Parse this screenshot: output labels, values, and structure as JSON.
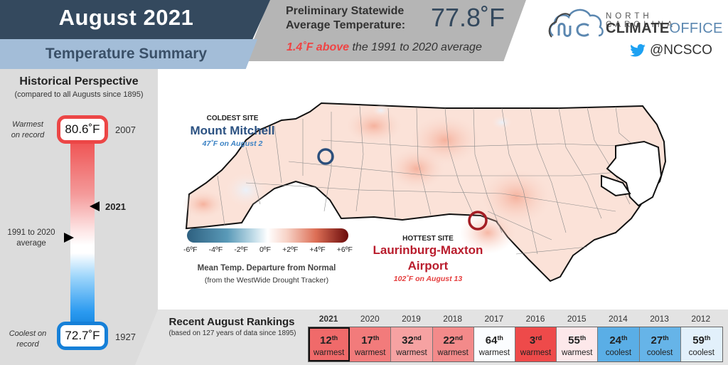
{
  "header": {
    "title": "August 2021",
    "subtitle": "Temperature Summary",
    "prelim_label_line1": "Preliminary Statewide",
    "prelim_label_line2": "Average Temperature:",
    "prelim_value": "77.8˚F",
    "departure_highlight": "1.4˚F above",
    "departure_rest": " the 1991 to 2020 average"
  },
  "logo": {
    "line1": "NORTH CAROLINA",
    "line2_bold": "CLIMATE",
    "line2_light": "OFFICE",
    "twitter_handle": "@NCSCO"
  },
  "historical": {
    "title": "Historical Perspective",
    "subtitle": "(compared to all Augusts since 1895)",
    "warmest_label_1": "Warmest",
    "warmest_label_2": "on record",
    "warmest_value": "80.6˚F",
    "warmest_year": "2007",
    "coolest_label_1": "Coolest on",
    "coolest_label_2": "record",
    "coolest_value": "72.7˚F",
    "coolest_year": "1927",
    "current_year_marker": "2021",
    "average_label_1": "1991 to 2020",
    "average_label_2": "average",
    "colors": {
      "warm": "#ec4646",
      "cool": "#1680d8"
    }
  },
  "map": {
    "coldest": {
      "kicker": "COLDEST SITE",
      "name": "Mount Mitchell",
      "detail": "47˚F on August 2",
      "color": "#2c5282"
    },
    "hottest": {
      "kicker": "HOTTEST SITE",
      "name_line1": "Laurinburg-Maxton",
      "name_line2": "Airport",
      "detail": "102˚F on August 13",
      "color": "#b91c2c"
    },
    "legend": {
      "ticks": [
        "-6ºF",
        "-4ºF",
        "-2ºF",
        "0ºF",
        "+2ºF",
        "+4ºF",
        "+6ºF"
      ],
      "caption": "Mean Temp. Departure from Normal",
      "source": "(from the WestWide Drought Tracker)"
    }
  },
  "rankings": {
    "title": "Recent August Rankings",
    "subtitle": "(based on 127 years of data since 1895)",
    "items": [
      {
        "year": "2021",
        "rank": "12",
        "suffix": "th",
        "type": "warmest",
        "color": "#f06a6a",
        "current": true
      },
      {
        "year": "2020",
        "rank": "17",
        "suffix": "th",
        "type": "warmest",
        "color": "#f27b7b",
        "current": false
      },
      {
        "year": "2019",
        "rank": "32",
        "suffix": "nd",
        "type": "warmest",
        "color": "#f6a2a2",
        "current": false
      },
      {
        "year": "2018",
        "rank": "22",
        "suffix": "nd",
        "type": "warmest",
        "color": "#f38a8a",
        "current": false
      },
      {
        "year": "2017",
        "rank": "64",
        "suffix": "th",
        "type": "warmest",
        "color": "#fbfdff",
        "current": false
      },
      {
        "year": "2016",
        "rank": "3",
        "suffix": "rd",
        "type": "warmest",
        "color": "#ee4a4a",
        "current": false
      },
      {
        "year": "2015",
        "rank": "55",
        "suffix": "th",
        "type": "warmest",
        "color": "#fde8ea",
        "current": false
      },
      {
        "year": "2014",
        "rank": "24",
        "suffix": "th",
        "type": "coolest",
        "color": "#5aaee6",
        "current": false
      },
      {
        "year": "2013",
        "rank": "27",
        "suffix": "th",
        "type": "coolest",
        "color": "#66b4e8",
        "current": false
      },
      {
        "year": "2012",
        "rank": "59",
        "suffix": "th",
        "type": "coolest",
        "color": "#e2f0fb",
        "current": false
      }
    ]
  }
}
